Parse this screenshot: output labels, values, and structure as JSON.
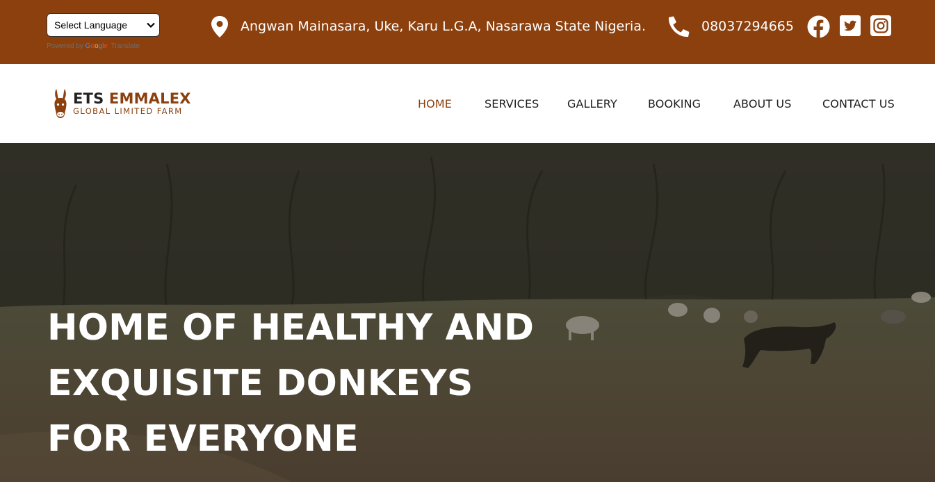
{
  "topbar": {
    "language_select": {
      "selected": "Select Language"
    },
    "powered_by": "Powered by",
    "powered_google": [
      "G",
      "o",
      "o",
      "g",
      "l",
      "e"
    ],
    "powered_translate": "Translate",
    "address": "Angwan Mainasara, Uke, Karu L.G.A, Nasarawa State Nigeria.",
    "phone": "08037294665",
    "icons": [
      "location-pin-icon",
      "phone-icon",
      "facebook-icon",
      "twitter-icon",
      "instagram-icon"
    ]
  },
  "header": {
    "logo": {
      "main_1": "ETS",
      "main_2": "EMMALEX",
      "sub": "GLOBAL LIMITED FARM"
    },
    "nav": [
      "HOME",
      "SERVICES",
      "GALLERY",
      "BOOKING",
      "ABOUT US",
      "CONTACT US"
    ],
    "active_nav": "HOME"
  },
  "hero": {
    "title": "HOME OF HEALTHY AND EXQUISITE DONKEYS FOR EVERYONE"
  },
  "colors": {
    "brand": "#8b400e",
    "nav_text": "#1d1d1d",
    "hero_text": "#ffffff"
  }
}
